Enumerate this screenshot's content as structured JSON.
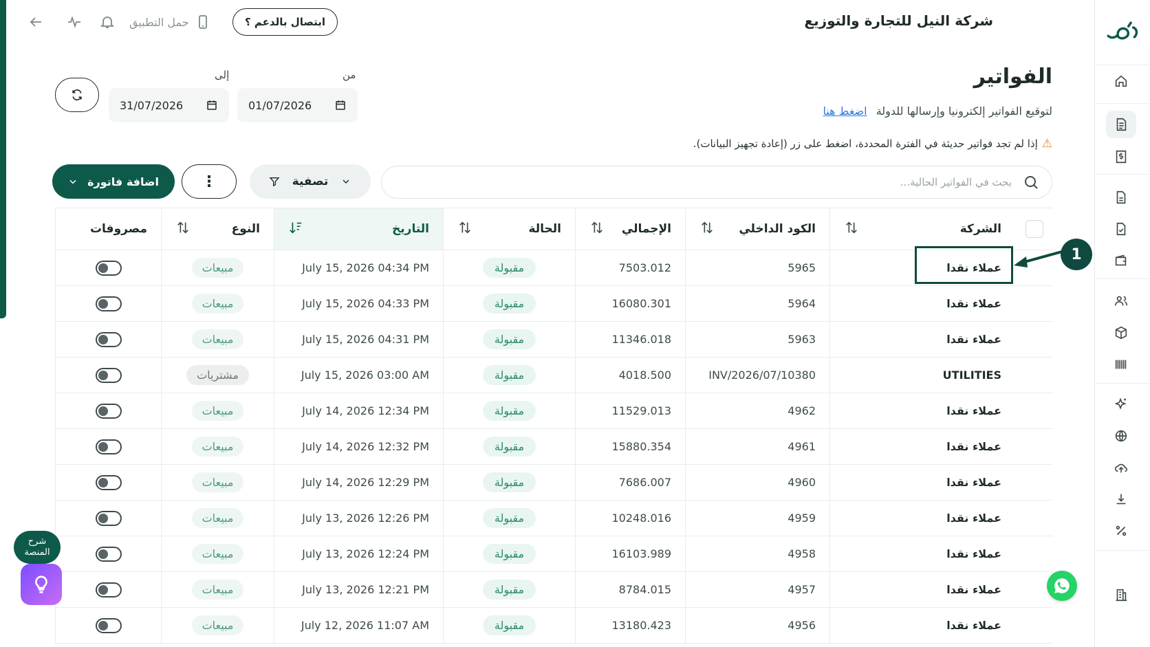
{
  "topbar": {
    "company_name": "شركة النيل للتجارة والتوزيع",
    "support_label": "ابتصال بالدعم ؟",
    "get_app_label": "حمل التطبيق"
  },
  "page": {
    "title": "الفواتير",
    "subtitle": "لتوقيع الفواتير إلكترونيا وإرسالها للدولة",
    "subtitle_link": "اضغط هنا",
    "warning": "إذا لم تجد فواتير حديثة في الفترة المحددة، اضغط على زر (إعادة تجهيز البيانات)."
  },
  "filters": {
    "from_label": "من",
    "from_value": "01/07/2026",
    "to_label": "إلى",
    "to_value": "31/07/2026"
  },
  "toolbar": {
    "search_placeholder": "بحث في الفواتير الحالية...",
    "filter_label": "تصفية",
    "more_label": "⋮",
    "add_label": "اضافة فاتورة"
  },
  "table": {
    "headers": {
      "company": "الشركة",
      "code": "الكود الداخلي",
      "total": "الإجمالي",
      "status": "الحالة",
      "date": "التاريخ",
      "type": "النوع",
      "expenses": "مصروفات"
    },
    "rows": [
      {
        "company": "عملاء نقدا",
        "code": "5965",
        "total": "7503.012",
        "status": "مقبولة",
        "date": "July 15, 2026 04:34 PM",
        "type": "مبيعات",
        "kind": "sale"
      },
      {
        "company": "عملاء نقدا",
        "code": "5964",
        "total": "16080.301",
        "status": "مقبولة",
        "date": "July 15, 2026 04:33 PM",
        "type": "مبيعات",
        "kind": "sale"
      },
      {
        "company": "عملاء نقدا",
        "code": "5963",
        "total": "11346.018",
        "status": "مقبولة",
        "date": "July 15, 2026 04:31 PM",
        "type": "مبيعات",
        "kind": "sale"
      },
      {
        "company": "UTILITIES",
        "code": "INV/2026/07/10380",
        "total": "4018.500",
        "status": "مقبولة",
        "date": "July 15, 2026 03:00 AM",
        "type": "مشتريات",
        "kind": "purchase"
      },
      {
        "company": "عملاء نقدا",
        "code": "4962",
        "total": "11529.013",
        "status": "مقبولة",
        "date": "July 14, 2026 12:34 PM",
        "type": "مبيعات",
        "kind": "sale"
      },
      {
        "company": "عملاء نقدا",
        "code": "4961",
        "total": "15880.354",
        "status": "مقبولة",
        "date": "July 14, 2026 12:32 PM",
        "type": "مبيعات",
        "kind": "sale"
      },
      {
        "company": "عملاء نقدا",
        "code": "4960",
        "total": "7686.007",
        "status": "مقبولة",
        "date": "July 14, 2026 12:29 PM",
        "type": "مبيعات",
        "kind": "sale"
      },
      {
        "company": "عملاء نقدا",
        "code": "4959",
        "total": "10248.016",
        "status": "مقبولة",
        "date": "July 13, 2026 12:26 PM",
        "type": "مبيعات",
        "kind": "sale"
      },
      {
        "company": "عملاء نقدا",
        "code": "4958",
        "total": "16103.989",
        "status": "مقبولة",
        "date": "July 13, 2026 12:24 PM",
        "type": "مبيعات",
        "kind": "sale"
      },
      {
        "company": "عملاء نقدا",
        "code": "4957",
        "total": "8784.015",
        "status": "مقبولة",
        "date": "July 13, 2026 12:21 PM",
        "type": "مبيعات",
        "kind": "sale"
      },
      {
        "company": "عملاء نقدا",
        "code": "4956",
        "total": "13180.423",
        "status": "مقبولة",
        "date": "July 12, 2026 11:07 AM",
        "type": "مبيعات",
        "kind": "sale"
      }
    ]
  },
  "annotation": {
    "number": "1"
  },
  "floating": {
    "explain_line1": "شرح",
    "explain_line2": "المنصة"
  },
  "colors": {
    "brand": "#0e5a4a",
    "accepted": "#2b8a6a",
    "warning": "#e38b1f",
    "link": "#2b7bd6"
  },
  "icons": [
    "home-icon",
    "invoice-icon",
    "dollar-doc-icon",
    "file-icon",
    "file-check-icon",
    "wallet-icon",
    "users-icon",
    "box-icon",
    "barcode-icon",
    "sparkle-icon",
    "globe-icon",
    "cloud-upload-icon",
    "download-icon",
    "percent-icon",
    "building-icon"
  ]
}
